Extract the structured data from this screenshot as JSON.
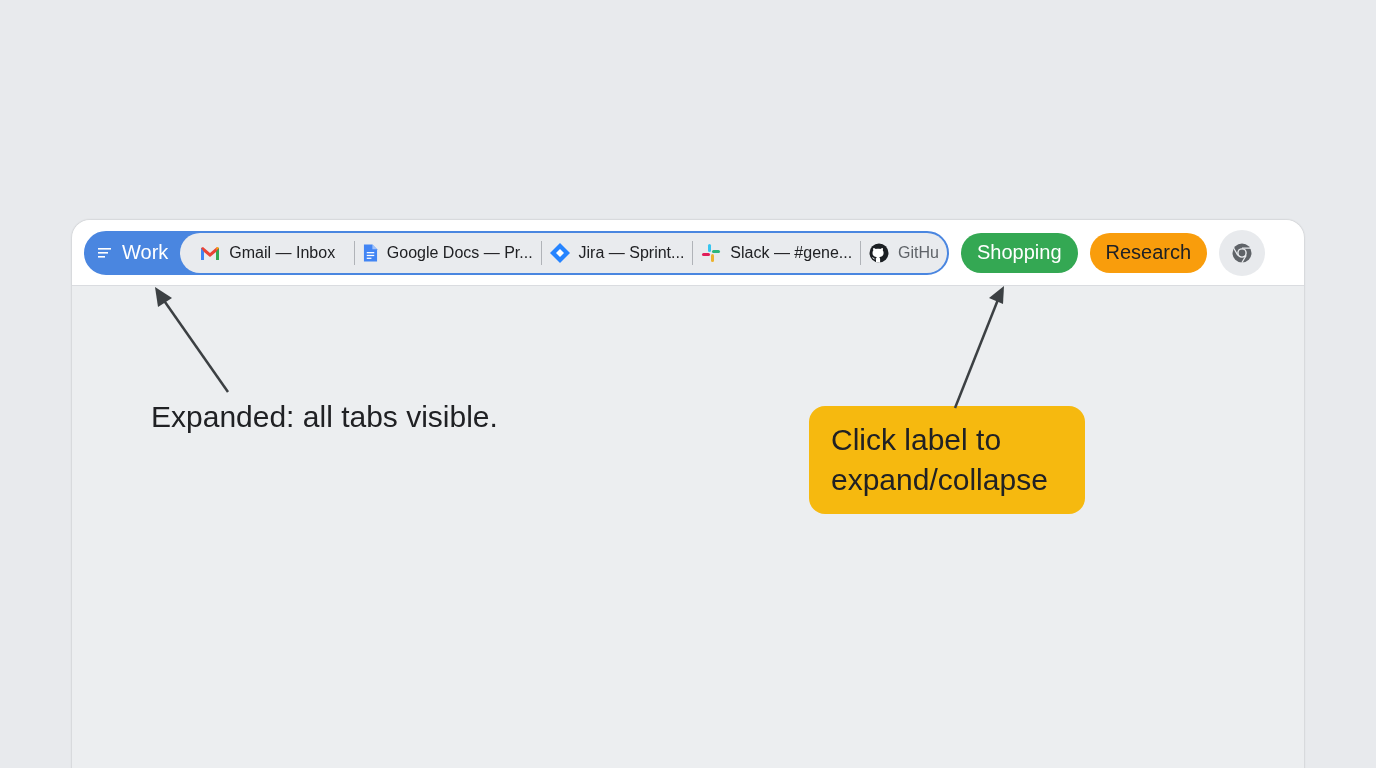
{
  "tab_groups": [
    {
      "label": "Work",
      "color": "#4a86e0",
      "expanded": true,
      "tabs": [
        {
          "title": "Gmail — Inbox"
        },
        {
          "title": "Google Docs — Pr..."
        },
        {
          "title": "Jira — Sprint..."
        },
        {
          "title": "Slack — #gene..."
        },
        {
          "title": "GitHu"
        }
      ]
    },
    {
      "label": "Shopping",
      "color": "#34a853",
      "expanded": false
    },
    {
      "label": "Research",
      "color": "#f99d0c",
      "expanded": false
    }
  ],
  "annotations": [
    {
      "kind": "plain",
      "text": "Expanded: all tabs visible."
    },
    {
      "kind": "callout",
      "text": "Click label to expand/collapse"
    }
  ]
}
